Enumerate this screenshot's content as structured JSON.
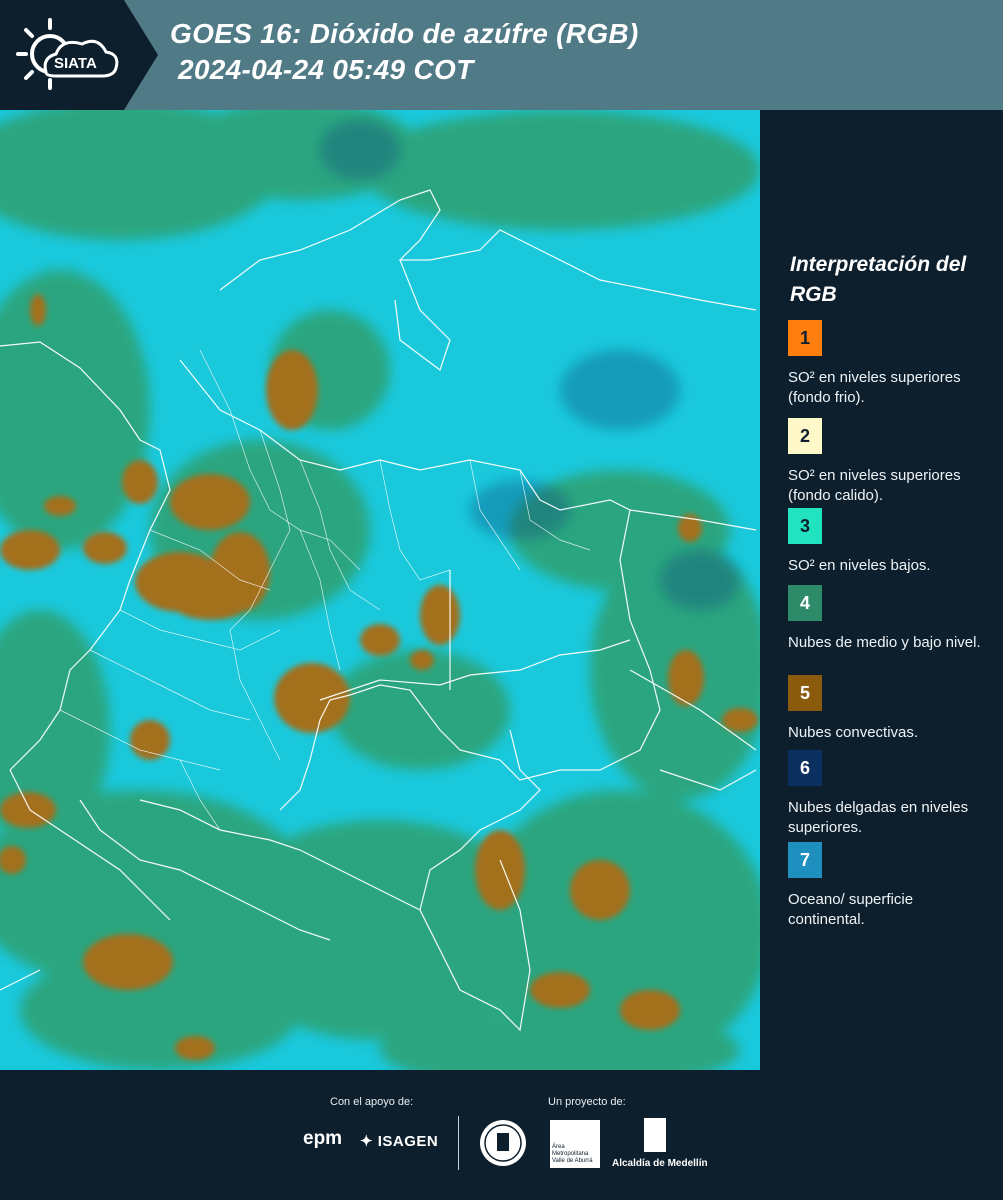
{
  "header": {
    "logo_text": "SIATA",
    "title_line1": "GOES 16: Dióxido de azúfre (RGB)",
    "title_line2": "2024-04-24 05:49 COT"
  },
  "map": {
    "product": "SO2 RGB composite",
    "background_color": "#1ac8dc",
    "border_color": "#ffffff"
  },
  "legend": {
    "title": "Interpretación del RGB",
    "items": [
      {
        "number": "1",
        "color": "#ff7f0e",
        "text": "SO² en niveles superiores (fondo frio)."
      },
      {
        "number": "2",
        "color": "#fff8c8",
        "text": "SO² en niveles superiores (fondo calido)."
      },
      {
        "number": "3",
        "color": "#22e3c0",
        "text": "SO² en niveles bajos."
      },
      {
        "number": "4",
        "color": "#2e8b6a",
        "text": "Nubes de medio y bajo nivel."
      },
      {
        "number": "5",
        "color": "#8a5a0d",
        "text": "Nubes convectivas."
      },
      {
        "number": "6",
        "color": "#0b2f5e",
        "text": "Nubes delgadas en niveles superiores."
      },
      {
        "number": "7",
        "color": "#1f8fc0",
        "text": "Oceano/ superficie continental."
      }
    ]
  },
  "footer": {
    "support_label": "Con el apoyo de:",
    "project_label": "Un proyecto de:",
    "sponsor1": "epm",
    "sponsor2": "ISAGEN",
    "partner1": "Área Metropolitana Valle de Aburrá",
    "partner2": "Alcaldía de Medellín"
  }
}
